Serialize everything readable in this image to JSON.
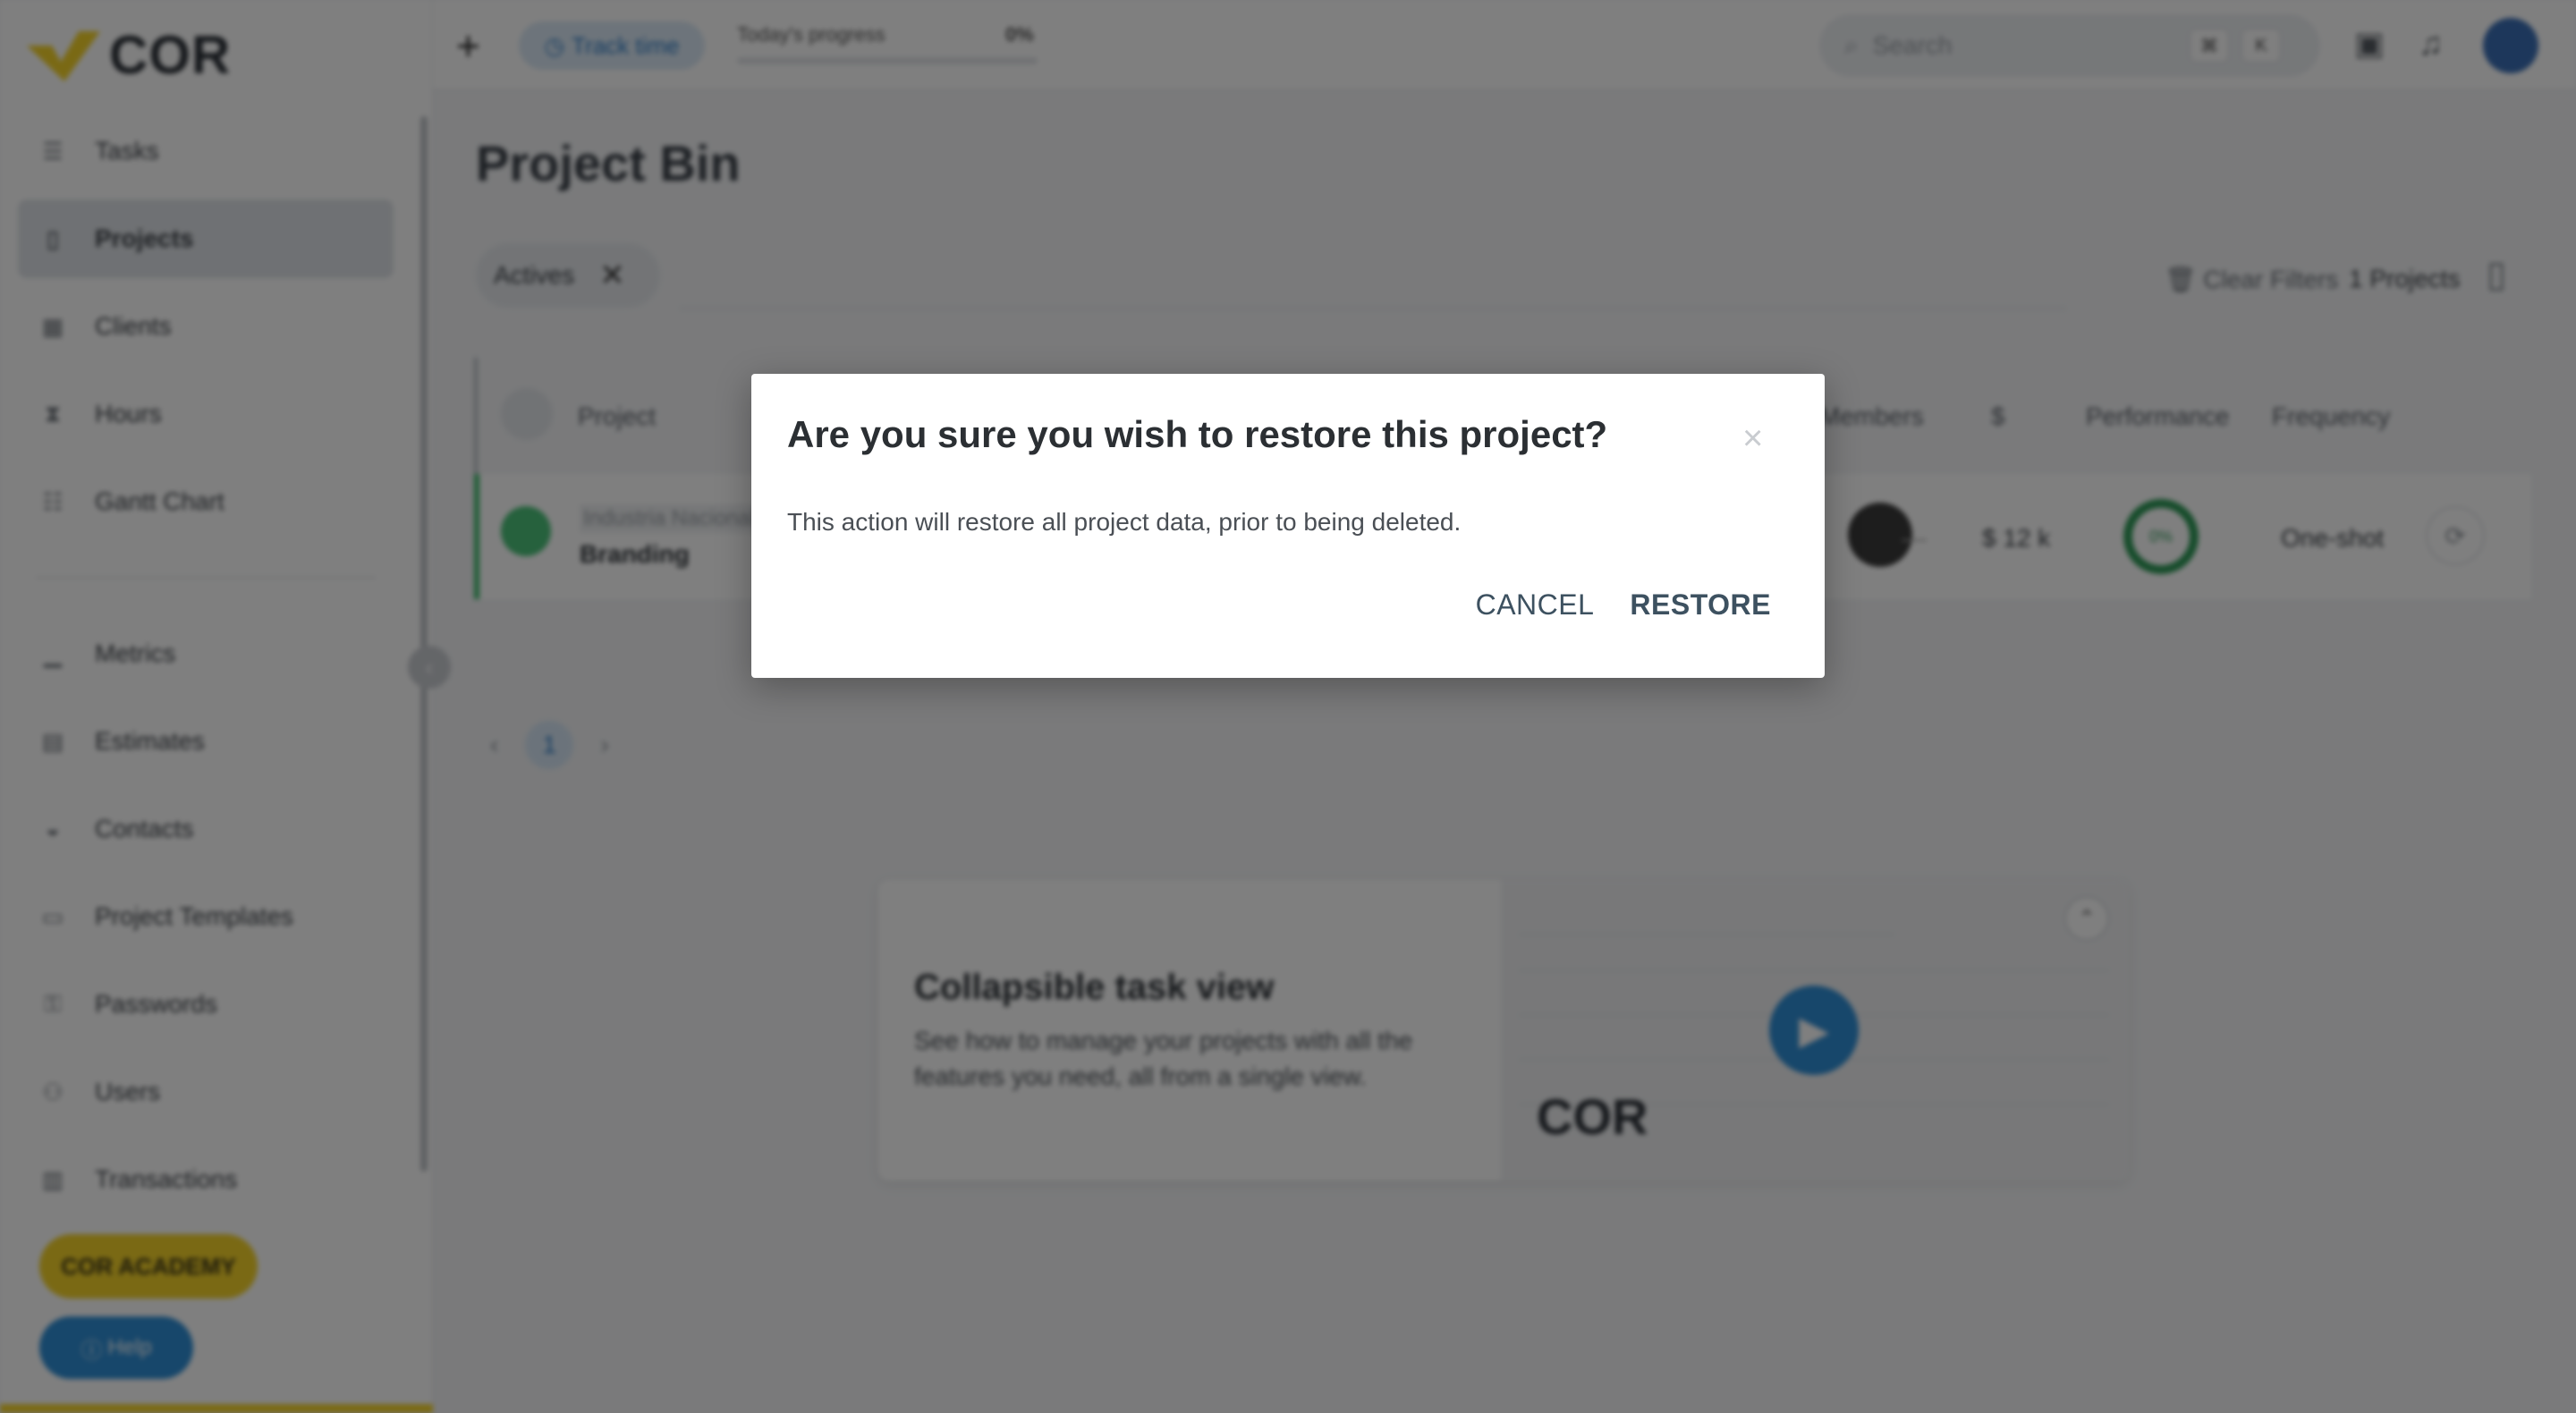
{
  "app": {
    "logo_text": "COR",
    "brand_colors": {
      "yellow": "#f5d329",
      "blue": "#2e8ed6",
      "green": "#3cb96a"
    }
  },
  "sidebar": {
    "items": [
      {
        "label": "Tasks",
        "icon": "tasks-icon",
        "active": false
      },
      {
        "label": "Projects",
        "icon": "projects-icon",
        "active": true
      },
      {
        "label": "Clients",
        "icon": "clients-icon",
        "active": false
      },
      {
        "label": "Hours",
        "icon": "hourglass-icon",
        "active": false
      },
      {
        "label": "Gantt Chart",
        "icon": "gantt-icon",
        "active": false
      },
      {
        "label": "Metrics",
        "icon": "metrics-icon",
        "active": false
      },
      {
        "label": "Estimates",
        "icon": "estimates-icon",
        "active": false
      },
      {
        "label": "Contacts",
        "icon": "contacts-icon",
        "active": false
      },
      {
        "label": "Project Templates",
        "icon": "templates-icon",
        "active": false
      },
      {
        "label": "Passwords",
        "icon": "key-icon",
        "active": false
      },
      {
        "label": "Users",
        "icon": "users-icon",
        "active": false
      },
      {
        "label": "Transactions",
        "icon": "transactions-icon",
        "active": false
      }
    ],
    "academy_label": "COR ACADEMY",
    "help_label": "Help"
  },
  "topbar": {
    "track_time_label": "Track time",
    "progress_label": "Today's progress",
    "progress_value": "0%",
    "search_placeholder": "Search",
    "search_key_1": "⌘",
    "search_key_2": "K"
  },
  "page": {
    "title": "Project Bin",
    "filter_chip": "Actives",
    "clear_filters": "Clear Filters",
    "project_count": "1 Projects"
  },
  "table": {
    "headers": {
      "project": "Project",
      "members": "Members",
      "budget": "$",
      "performance": "Performance",
      "frequency": "Frequency"
    },
    "rows": [
      {
        "client": "Industria Nacional",
        "name": "Branding",
        "budget": "$ 12 k",
        "performance": "0%",
        "frequency": "One-shot"
      }
    ]
  },
  "pagination": {
    "current_page": "1"
  },
  "promo": {
    "title": "Collapsible task view",
    "text": "See how to manage your projects with all the features you need, all from a single view.",
    "video_logo": "COR"
  },
  "dialog": {
    "title": "Are you sure you wish to restore this project?",
    "body": "This action will restore all project data, prior to being deleted.",
    "cancel_label": "CANCEL",
    "restore_label": "RESTORE",
    "close_icon": "×"
  }
}
